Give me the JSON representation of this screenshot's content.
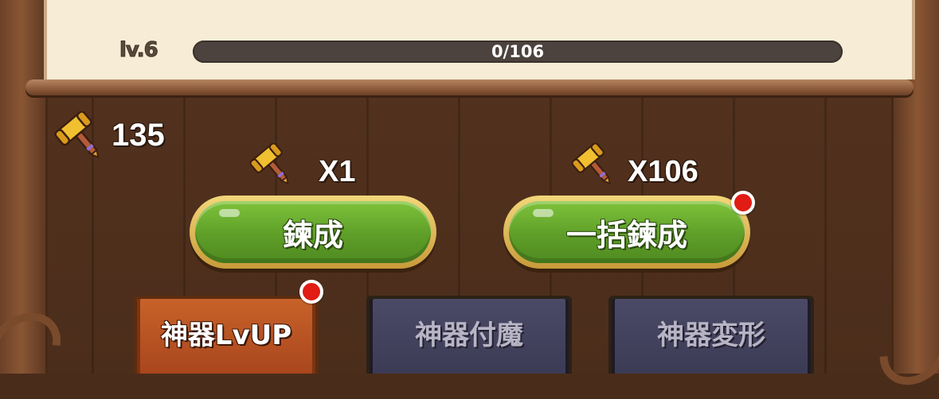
{
  "level": {
    "label": "lv.6",
    "progress_text": "0/106",
    "progress_current": 0,
    "progress_max": 106
  },
  "material": {
    "icon": "hammer-icon",
    "owned_count": "135"
  },
  "actions": [
    {
      "cost": "X1",
      "label": "鍊成",
      "has_notification": false
    },
    {
      "cost": "X106",
      "label": "一括鍊成",
      "has_notification": true
    }
  ],
  "tabs": [
    {
      "label": "神器LvUP",
      "active": true,
      "has_notification": true
    },
    {
      "label": "神器付魔",
      "active": false,
      "has_notification": false
    },
    {
      "label": "神器変形",
      "active": false,
      "has_notification": false
    }
  ],
  "colors": {
    "button_green": "#5e9e28",
    "active_tab": "#c8622a",
    "inactive_tab": "#4b4a66",
    "notification_red": "#e01c14",
    "parchment": "#f7ecd5"
  }
}
